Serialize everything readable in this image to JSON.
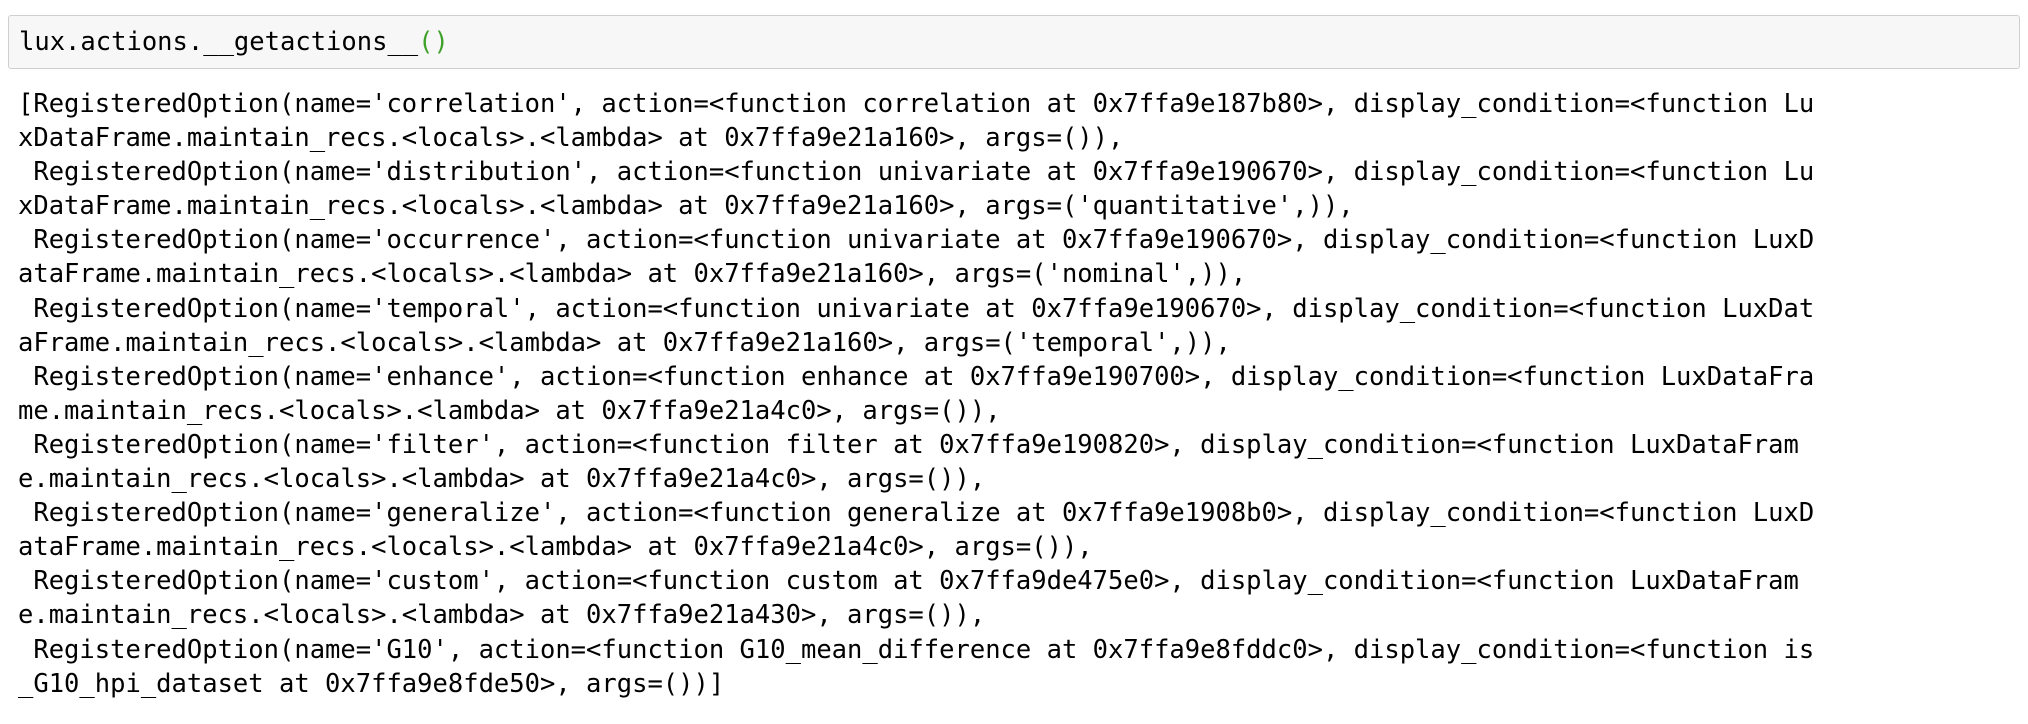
{
  "input": {
    "code_text": "lux.actions.__getactions__",
    "code_parens": "()"
  },
  "output": {
    "lines": [
      "[RegisteredOption(name='correlation', action=<function correlation at 0x7ffa9e187b80>, display_condition=<function Lu",
      "xDataFrame.maintain_recs.<locals>.<lambda> at 0x7ffa9e21a160>, args=()),",
      " RegisteredOption(name='distribution', action=<function univariate at 0x7ffa9e190670>, display_condition=<function Lu",
      "xDataFrame.maintain_recs.<locals>.<lambda> at 0x7ffa9e21a160>, args=('quantitative',)),",
      " RegisteredOption(name='occurrence', action=<function univariate at 0x7ffa9e190670>, display_condition=<function LuxD",
      "ataFrame.maintain_recs.<locals>.<lambda> at 0x7ffa9e21a160>, args=('nominal',)),",
      " RegisteredOption(name='temporal', action=<function univariate at 0x7ffa9e190670>, display_condition=<function LuxDat",
      "aFrame.maintain_recs.<locals>.<lambda> at 0x7ffa9e21a160>, args=('temporal',)),",
      " RegisteredOption(name='enhance', action=<function enhance at 0x7ffa9e190700>, display_condition=<function LuxDataFra",
      "me.maintain_recs.<locals>.<lambda> at 0x7ffa9e21a4c0>, args=()),",
      " RegisteredOption(name='filter', action=<function filter at 0x7ffa9e190820>, display_condition=<function LuxDataFram",
      "e.maintain_recs.<locals>.<lambda> at 0x7ffa9e21a4c0>, args=()),",
      " RegisteredOption(name='generalize', action=<function generalize at 0x7ffa9e1908b0>, display_condition=<function LuxD",
      "ataFrame.maintain_recs.<locals>.<lambda> at 0x7ffa9e21a4c0>, args=()),",
      " RegisteredOption(name='custom', action=<function custom at 0x7ffa9de475e0>, display_condition=<function LuxDataFram",
      "e.maintain_recs.<locals>.<lambda> at 0x7ffa9e21a430>, args=()),",
      " RegisteredOption(name='G10', action=<function G10_mean_difference at 0x7ffa9e8fddc0>, display_condition=<function is",
      "_G10_hpi_dataset at 0x7ffa9e8fde50>, args=())]"
    ]
  }
}
